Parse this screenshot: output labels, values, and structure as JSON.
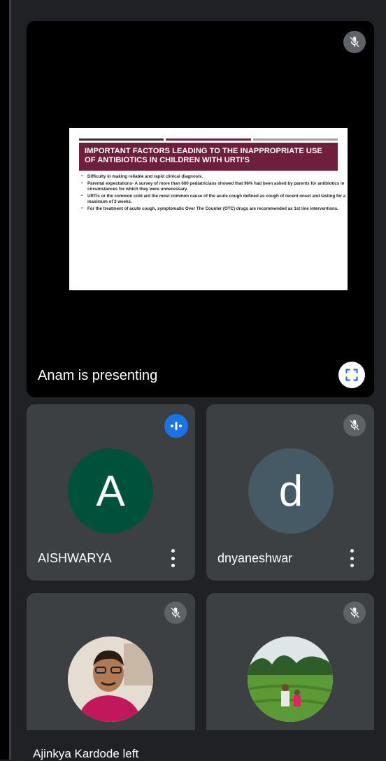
{
  "presentation": {
    "presenting_text": "Anam is presenting",
    "slide": {
      "title": "IMPORTANT FACTORS LEADING TO THE INAPPROPRIATE USE OF ANTIBIOTICS IN CHILDREN WITH URTI'S",
      "bullets": [
        "Difficulty in making reliable and rapid clinical diagnosis.",
        "Parental expectations- A survey of more than 600 pediatricians showed that 96% had been asked by parents for antibiotics in circumstances for which they were unnecessary.",
        "URTIs or the common cold ard the most common cause of the acute cough defined as cough of recent onset and lasting for a maximum of 3 weeks.",
        "For the treatment of acute cough, symptomatic Over The Counter (OTC) drugs are recommended as 1st line interventions."
      ],
      "accent_color": "#6d1f3c"
    }
  },
  "participants": [
    {
      "name": "AISHWARYA",
      "initial": "A",
      "avatar_color": "#00513c",
      "status": "speaking"
    },
    {
      "name": "dnyaneshwar",
      "initial": "d",
      "avatar_color": "#455a64",
      "status": "muted"
    },
    {
      "name": "",
      "avatar": "photo-man",
      "status": "muted"
    },
    {
      "name": "",
      "avatar": "photo-tea-garden",
      "status": "muted"
    }
  ],
  "notification": {
    "text": "Ajinkya Kardode left"
  },
  "icons": [
    "mic-off-icon",
    "speaking-icon",
    "fullscreen-icon",
    "more-vert-icon"
  ]
}
